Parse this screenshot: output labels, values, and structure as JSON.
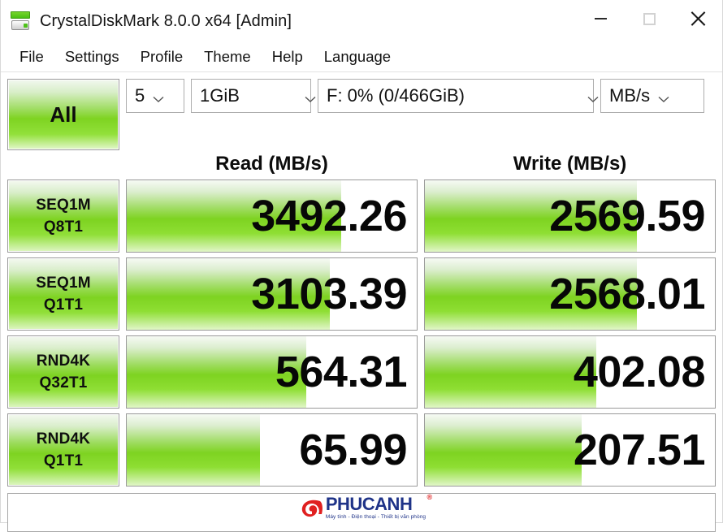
{
  "window": {
    "title": "CrystalDiskMark 8.0.0 x64 [Admin]",
    "icon": "disk-drive-icon",
    "controls": {
      "minimize": "minimize-icon",
      "maximize": "maximize-icon",
      "close": "close-icon"
    }
  },
  "menu": {
    "items": [
      {
        "label": "File"
      },
      {
        "label": "Settings"
      },
      {
        "label": "Profile"
      },
      {
        "label": "Theme"
      },
      {
        "label": "Help"
      },
      {
        "label": "Language"
      }
    ]
  },
  "toolbar": {
    "all_button_label": "All",
    "test_count": "5",
    "test_size": "1GiB",
    "target_drive": "F: 0% (0/466GiB)",
    "unit": "MB/s",
    "caret_icon": "chevron-down-icon"
  },
  "headers": {
    "read": "Read (MB/s)",
    "write": "Write (MB/s)"
  },
  "chart_data": {
    "type": "bar",
    "title": "CrystalDiskMark 8.0.0 x64 benchmark results",
    "xlabel": "",
    "ylabel": "MB/s",
    "categories": [
      "SEQ1M Q8T1",
      "SEQ1M Q1T1",
      "RND4K Q32T1",
      "RND4K Q1T1"
    ],
    "series": [
      {
        "name": "Read (MB/s)",
        "values": [
          3492.26,
          3103.39,
          564.31,
          65.99
        ]
      },
      {
        "name": "Write (MB/s)",
        "values": [
          2569.59,
          2568.01,
          402.08,
          207.51
        ]
      }
    ],
    "legend": "right",
    "grid": false
  },
  "rows": [
    {
      "label_top": "SEQ1M",
      "label_bottom": "Q8T1",
      "read": {
        "value": "3492.26",
        "fill_pct": 74
      },
      "write": {
        "value": "2569.59",
        "fill_pct": 73
      }
    },
    {
      "label_top": "SEQ1M",
      "label_bottom": "Q1T1",
      "read": {
        "value": "3103.39",
        "fill_pct": 70
      },
      "write": {
        "value": "2568.01",
        "fill_pct": 73
      }
    },
    {
      "label_top": "RND4K",
      "label_bottom": "Q32T1",
      "read": {
        "value": "564.31",
        "fill_pct": 62
      },
      "write": {
        "value": "402.08",
        "fill_pct": 59
      }
    },
    {
      "label_top": "RND4K",
      "label_bottom": "Q1T1",
      "read": {
        "value": "65.99",
        "fill_pct": 46
      },
      "write": {
        "value": "207.51",
        "fill_pct": 54
      }
    }
  ],
  "status": {
    "text": ""
  },
  "watermark": {
    "name": "PHUCANH",
    "registered": "®",
    "tagline": "Máy tính - Điện thoại - Thiết bị văn phòng",
    "logo_icon": "phucanh-logo-icon"
  },
  "colors": {
    "accent_green": "#7ed321",
    "brand_blue": "#1f3388",
    "brand_red": "#e02020"
  }
}
